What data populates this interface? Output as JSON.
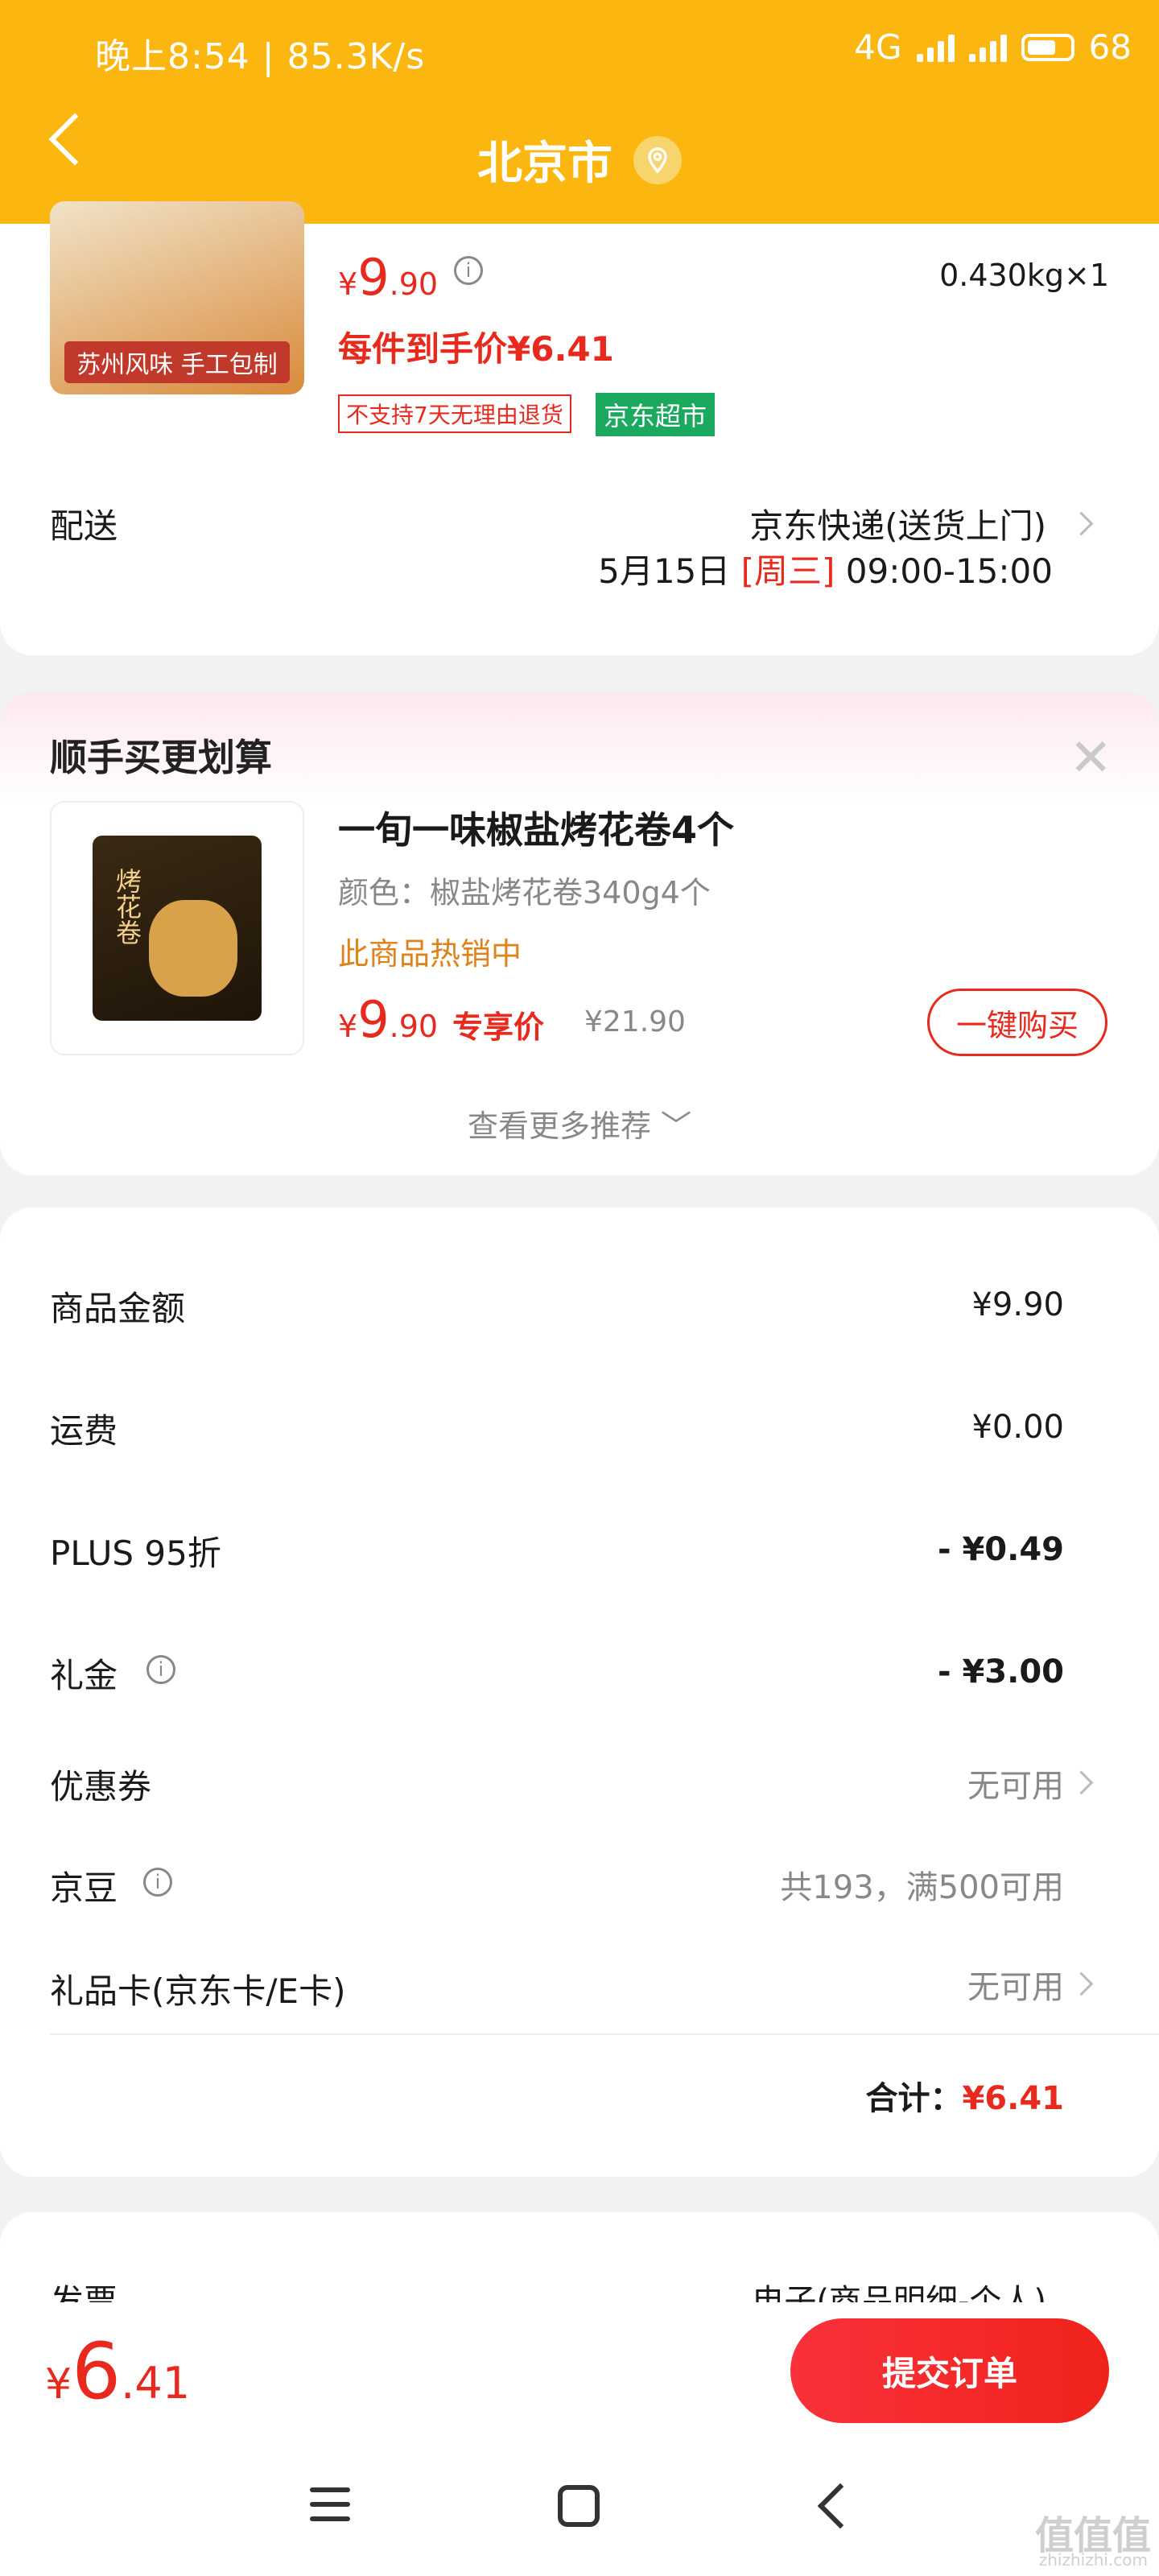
{
  "status_bar": {
    "time_speed": "晚上8:54 | 85.3K/s",
    "network": "4G",
    "battery": "68"
  },
  "header": {
    "city": "北京市",
    "icons": [
      "back-arrow-icon",
      "location-pin-icon"
    ]
  },
  "product": {
    "image_label": "苏州风味 手工包制",
    "price_symbol": "¥",
    "price_int": "9",
    "price_dec": ".90",
    "weight_qty": "0.430kg×1",
    "final_price_label": "每件到手价¥6.41",
    "no_return_tag": "不支持7天无理由退货",
    "store_tag": "京东超市"
  },
  "delivery": {
    "label": "配送",
    "method": "京东快递(送货上门)",
    "date": "5月15日",
    "weekday": "[周三]",
    "time": "09:00-15:00"
  },
  "recommend": {
    "title": "顺手买更划算",
    "close": "✕",
    "product_name": "一旬一味椒盐烤花卷4个",
    "spec": "颜色：椒盐烤花卷340g4个",
    "hot": "此商品热销中",
    "price_symbol": "¥",
    "price_int": "9",
    "price_dec": ".90",
    "exclusive": "专享价",
    "orig_price": "¥21.90",
    "buy_button": "一键购买",
    "more": "查看更多推荐 ﹀",
    "pack_label": "烤花卷"
  },
  "summary": {
    "rows": [
      {
        "label": "商品金额",
        "value": "¥9.90"
      },
      {
        "label": "运费",
        "value": "¥0.00"
      },
      {
        "label": "PLUS 95折",
        "value": "- ¥0.49"
      },
      {
        "label": "礼金",
        "value": "- ¥3.00"
      },
      {
        "label": "优惠券",
        "value": "无可用"
      },
      {
        "label": "京豆",
        "value": "共193，满500可用"
      },
      {
        "label": "礼品卡(京东卡/E卡)",
        "value": "无可用"
      }
    ],
    "total_label": "合计：",
    "total_value": "¥6.41"
  },
  "invoice": {
    "label": "发票",
    "value": "电子(商品明细-个人)"
  },
  "bottom": {
    "price_symbol": "¥",
    "price_int": "6",
    "price_dec": ".41",
    "submit": "提交订单"
  },
  "watermark": {
    "text": "值值值",
    "url": "zhizhizhi.com"
  },
  "colors": {
    "brand_yellow": "#fbb710",
    "price_red": "#e8291d",
    "green_tag": "#1aa95e"
  }
}
